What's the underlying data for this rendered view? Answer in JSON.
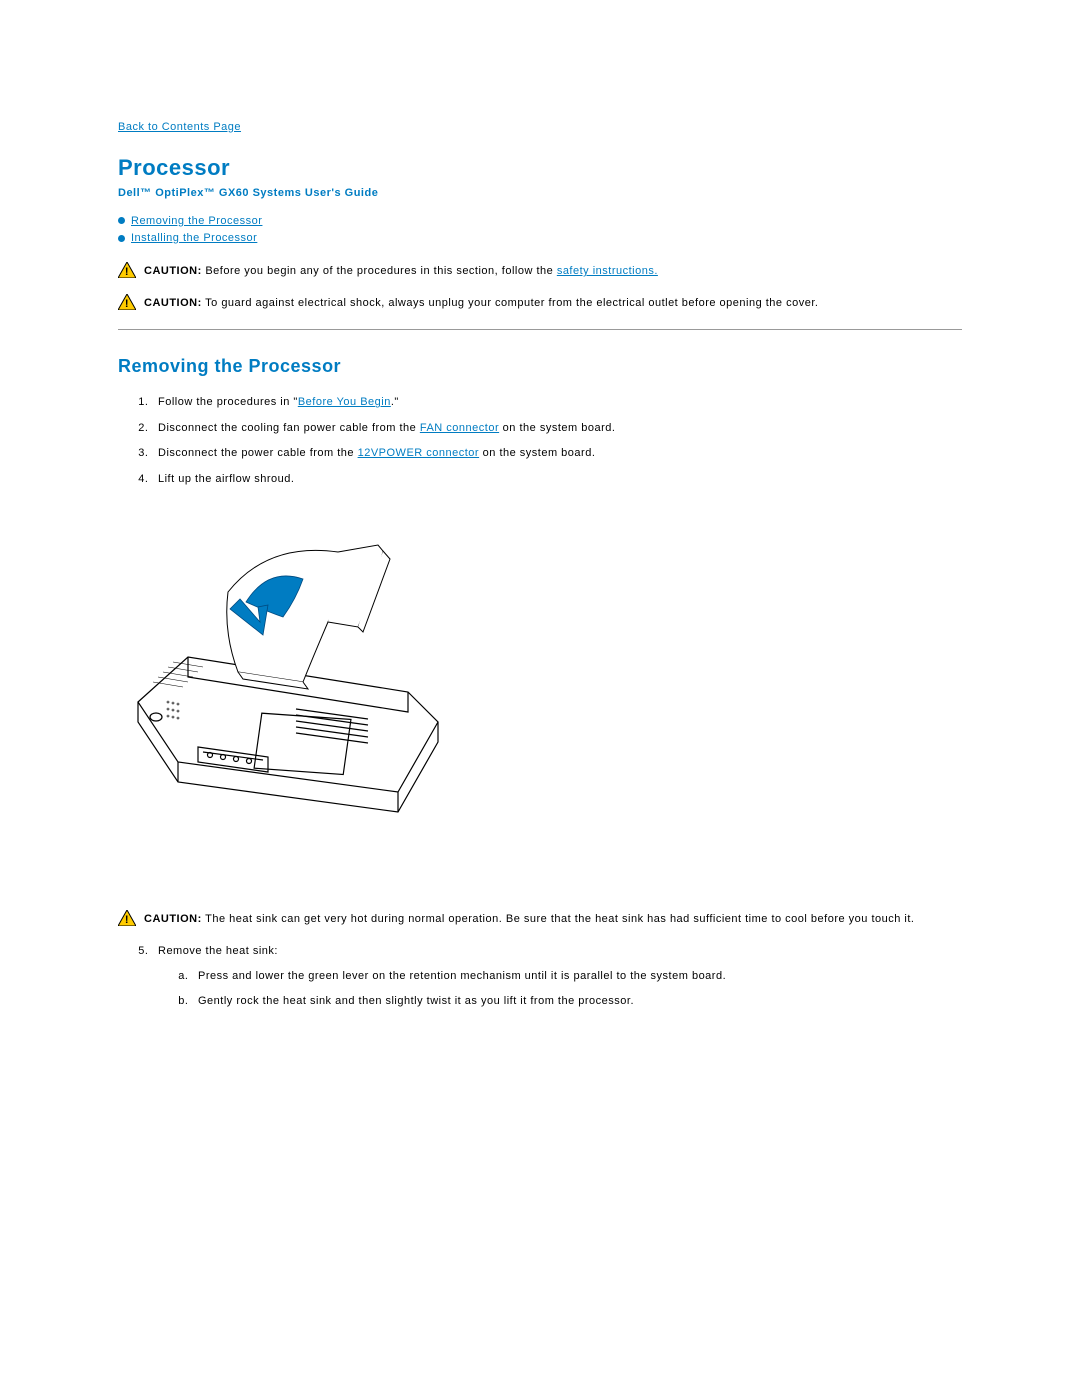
{
  "nav": {
    "back_label": "Back to Contents Page"
  },
  "header": {
    "title": "Processor",
    "subtitle": "Dell™ OptiPlex™ GX60 Systems User's Guide"
  },
  "toc": {
    "item1": "Removing the Processor",
    "item2": "Installing the Processor"
  },
  "caution1": {
    "label": "CAUTION:",
    "text_before": " Before you begin any of the procedures in this section, follow the ",
    "link": "safety instructions.",
    "text_after": ""
  },
  "caution2": {
    "label": "CAUTION:",
    "text": " To guard against electrical shock, always unplug your computer from the electrical outlet before opening the cover."
  },
  "section": {
    "heading": "Removing the Processor"
  },
  "steps": {
    "s1_before": "Follow the procedures in \"",
    "s1_link": "Before You Begin",
    "s1_after": ".\"",
    "s2_before": "Disconnect the cooling fan power cable from the ",
    "s2_link": "FAN connector",
    "s2_after": " on the system board.",
    "s3_before": "Disconnect the power cable from the ",
    "s3_link": "12VPOWER connector",
    "s3_after": " on the system board.",
    "s4": "Lift up the airflow shroud."
  },
  "caution3": {
    "label": "CAUTION:",
    "text": " The heat sink can get very hot during normal operation. Be sure that the heat sink has had sufficient time to cool before you touch it."
  },
  "steps2": {
    "s5": "Remove the heat sink:",
    "s5a": "Press and lower the green lever on the retention mechanism until it is parallel to the system board.",
    "s5b": "Gently rock the heat sink and then slightly twist it as you lift it from the processor."
  }
}
